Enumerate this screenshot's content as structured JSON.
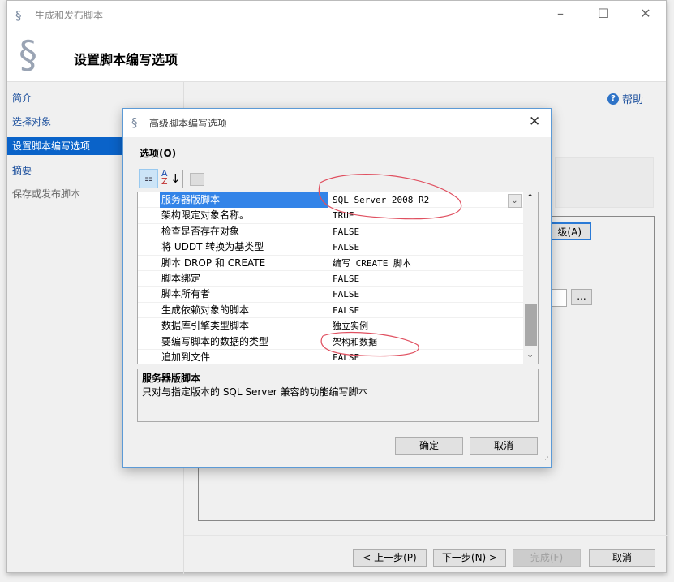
{
  "window": {
    "title": "生成和发布脚本",
    "header_title": "设置脚本编写选项"
  },
  "nav": [
    {
      "label": "简介"
    },
    {
      "label": "选择对象"
    },
    {
      "label": "设置脚本编写选项",
      "selected": true
    },
    {
      "label": "摘要"
    },
    {
      "label": "保存或发布脚本",
      "disabled": true
    }
  ],
  "help_label": "帮助",
  "partial_button": "级(A)",
  "browse_button": "...",
  "footer": {
    "prev": "< 上一步(P)",
    "next": "下一步(N) >",
    "finish": "完成(F)",
    "cancel": "取消"
  },
  "dialog": {
    "title": "高级脚本编写选项",
    "options_label": "选项(O)",
    "rows": [
      {
        "key": "服务器版脚本",
        "value": "SQL Server 2008 R2"
      },
      {
        "key": "架构限定对象名称。",
        "value": "TRUE"
      },
      {
        "key": "检查是否存在对象",
        "value": "FALSE"
      },
      {
        "key": "将 UDDT 转换为基类型",
        "value": "FALSE"
      },
      {
        "key": "脚本 DROP 和 CREATE",
        "value": "编写 CREATE 脚本"
      },
      {
        "key": "脚本绑定",
        "value": "FALSE"
      },
      {
        "key": "脚本所有者",
        "value": "FALSE"
      },
      {
        "key": "生成依赖对象的脚本",
        "value": "FALSE"
      },
      {
        "key": "数据库引擎类型脚本",
        "value": "独立实例"
      },
      {
        "key": "要编写脚本的数据的类型",
        "value": "架构和数据"
      },
      {
        "key": "追加到文件",
        "value": "FALSE"
      }
    ],
    "desc_title": "服务器版脚本",
    "desc_text": "只对与指定版本的 SQL Server 兼容的功能编写脚本",
    "ok": "确定",
    "cancel": "取消"
  },
  "annotation_color": "#e05060",
  "selection_color": "#0a63c9"
}
